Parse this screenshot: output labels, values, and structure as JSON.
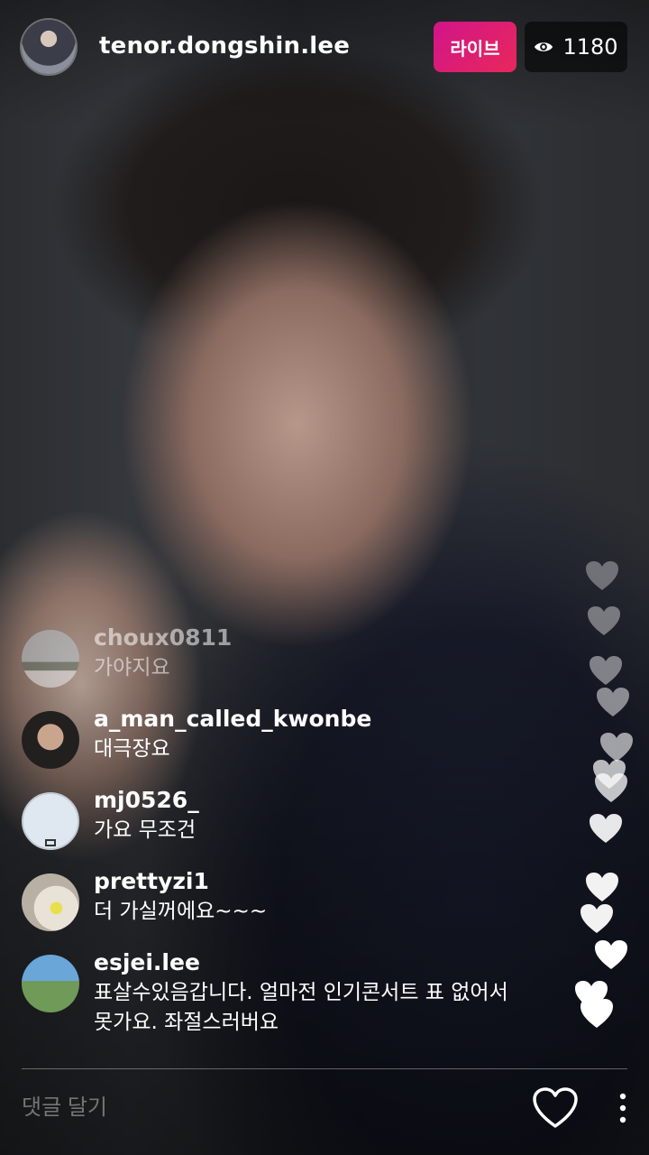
{
  "header": {
    "host_username": "tenor.dongshin.lee",
    "live_label": "라이브",
    "viewer_count": "1180"
  },
  "comments": [
    {
      "username": "choux0811",
      "text": "가야지요"
    },
    {
      "username": "a_man_called_kwonbe",
      "text": "대극장요"
    },
    {
      "username": "mj0526_",
      "text": "가요 무조건"
    },
    {
      "username": "prettyzi1",
      "text": "더 가실꺼에요~~~"
    },
    {
      "username": "esjei.lee",
      "text": "표살수있음갑니다. 얼마전 인기콘서트 표 없어서 못가요. 좌절스러버요"
    }
  ],
  "footer": {
    "comment_placeholder": "댓글 달기"
  },
  "icons": {
    "viewer": "eye-icon",
    "like": "heart-icon",
    "more": "more-vertical-icon"
  },
  "colors": {
    "live_badge": "#d1148a",
    "text": "#ffffff"
  }
}
